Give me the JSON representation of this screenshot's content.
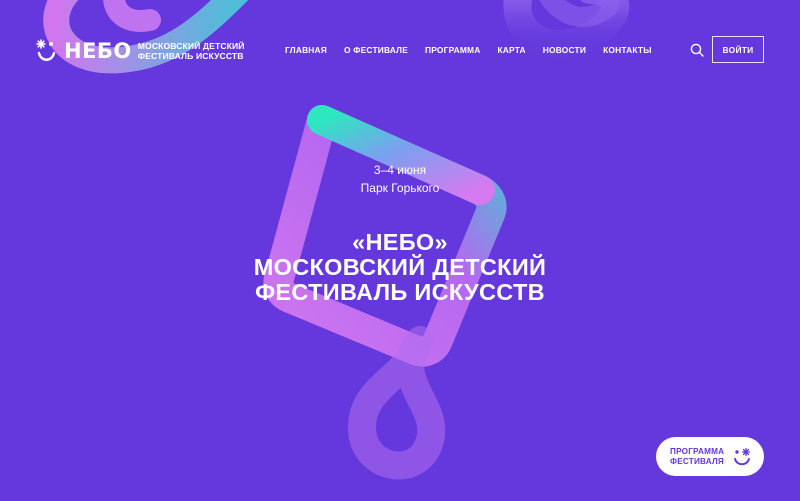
{
  "colors": {
    "background": "#6438dc",
    "accent_teal": "#2ee6c0",
    "accent_pink": "#d67af0",
    "button_bg": "#ffffff"
  },
  "header": {
    "logo_word": "НЕБО",
    "logo_sub_line1": "МОСКОВСКИЙ ДЕТСКИЙ",
    "logo_sub_line2": "ФЕСТИВАЛЬ ИСКУССТВ",
    "nav": [
      "ГЛАВНАЯ",
      "О ФЕСТИВАЛЕ",
      "ПРОГРАММА",
      "КАРТА",
      "НОВОСТИ",
      "КОНТАКТЫ"
    ],
    "search_icon": "search-icon",
    "login_label": "ВОЙТИ"
  },
  "hero": {
    "date": "3–4 июня",
    "place": "Парк Горького",
    "title_line1": "«НЕБО»",
    "title_line2": "МОСКОВСКИЙ ДЕТСКИЙ",
    "title_line3": "ФЕСТИВАЛЬ ИСКУССТВ"
  },
  "program_button": {
    "line1": "ПРОГРАММА",
    "line2": "ФЕСТИВАЛЯ",
    "icon": "smiley-logo-icon"
  }
}
